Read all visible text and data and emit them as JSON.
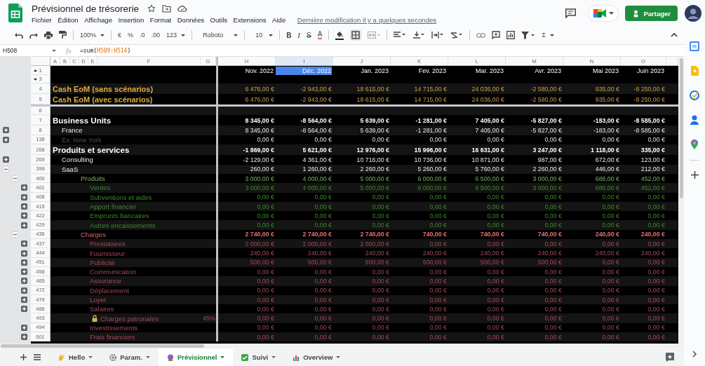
{
  "document": {
    "title": "Prévisionnel de trésorerie",
    "last_edit": "Dernière modification il y a quelques secondes"
  },
  "menu": [
    "Fichier",
    "Édition",
    "Affichage",
    "Insertion",
    "Format",
    "Données",
    "Outils",
    "Extensions",
    "Aide"
  ],
  "share_button": "Partager",
  "toolbar": {
    "zoom": "100%",
    "currency": "€",
    "percent": "%",
    "decimals_less": ".0",
    "decimals_more": ".00",
    "number_format": "123",
    "font": "Roboto",
    "font_size": "10",
    "bold": "B",
    "italic": "I",
    "strikethrough": "S",
    "text_color": "A",
    "functions": "Σ"
  },
  "formula_bar": {
    "cell": "H508",
    "function_label": "fx",
    "prefix": "=sum(",
    "range": "H509:H514",
    "suffix": ")"
  },
  "columns": {
    "frozen": [
      "A",
      "B",
      "C",
      "D",
      "E",
      "F",
      "G"
    ],
    "scrolling": [
      "H",
      "I",
      "J",
      "K",
      "L",
      "M",
      "N",
      "O"
    ]
  },
  "header_row": {
    "number": "1",
    "months": [
      {
        "label": "Nov. 2022",
        "highlighted": false
      },
      {
        "label": "Déc. 2022",
        "highlighted": true
      },
      {
        "label": "Jan. 2023",
        "highlighted": false
      },
      {
        "label": "Fev. 2023",
        "highlighted": false
      },
      {
        "label": "Mar. 2023",
        "highlighted": false
      },
      {
        "label": "Avr. 2023",
        "highlighted": false
      },
      {
        "label": "Mai 2023",
        "highlighted": false
      },
      {
        "label": "Juin 2023",
        "highlighted": false
      }
    ]
  },
  "frozen_rows": [
    {
      "number": "3",
      "kind": "blank"
    },
    {
      "number": "4",
      "kind": "gold",
      "label": "Cash EoM (sans scénarios)",
      "values": [
        "6 476,00 €",
        "-2 943,00 €",
        "18 615,00 €",
        "14 715,00 €",
        "24 036,00 €",
        "-2 580,00 €",
        "935,00 €",
        "-8 250,00 €"
      ]
    },
    {
      "number": "5",
      "kind": "gold",
      "label": "Cash EoM (avec scénarios)",
      "values": [
        "6 476,00 €",
        "-2 943,00 €",
        "18 615,00 €",
        "14 715,00 €",
        "24 036,00 €",
        "-2 580,00 €",
        "935,00 €",
        "-8 250,00 €"
      ]
    }
  ],
  "rows": [
    {
      "number": "6",
      "kind": "blank"
    },
    {
      "number": "7",
      "kind": "title",
      "label": "Business Units",
      "values": [
        "8 345,00 €",
        "-8 564,00 €",
        "5 639,00 €",
        "-1 281,00 €",
        "7 405,00 €",
        "-5 827,00 €",
        "-183,00 €",
        "-8 585,00 €"
      ]
    },
    {
      "number": "8",
      "kind": "item",
      "label": "France",
      "toggle": {
        "kind": "outer",
        "expanded": false
      },
      "values": [
        "8 345,00 €",
        "-8 564,00 €",
        "5 639,00 €",
        "-1 281,00 €",
        "7 405,00 €",
        "-5 827,00 €",
        "-183,00 €",
        "-8 585,00 €"
      ]
    },
    {
      "number": "138",
      "kind": "muted",
      "label": "Ex: New York",
      "toggle": {
        "kind": "outer",
        "expanded": false
      },
      "values": [
        "0,00 €",
        "0,00 €",
        "0,00 €",
        "0,00 €",
        "0,00 €",
        "0,00 €",
        "0,00 €",
        "0,00 €"
      ]
    },
    {
      "number": "268",
      "kind": "title",
      "label": "Produits et services",
      "values": [
        "-1 869,00 €",
        "5 621,00 €",
        "12 976,00 €",
        "15 996,00 €",
        "16 631,00 €",
        "3 247,00 €",
        "1 118,00 €",
        "335,00 €"
      ]
    },
    {
      "number": "269",
      "kind": "item",
      "label": "Consulting",
      "toggle": {
        "kind": "outer",
        "expanded": false
      },
      "values": [
        "-2 129,00 €",
        "4 361,00 €",
        "10 716,00 €",
        "10 736,00 €",
        "10 871,00 €",
        "987,00 €",
        "672,00 €",
        "123,00 €"
      ]
    },
    {
      "number": "399",
      "kind": "item",
      "label": "SaaS",
      "toggle": {
        "kind": "outer",
        "expanded": true
      },
      "values": [
        "260,00 €",
        "1 260,00 €",
        "2 260,00 €",
        "5 260,00 €",
        "5 760,00 €",
        "2 260,00 €",
        "446,00 €",
        "212,00 €"
      ]
    },
    {
      "number": "400",
      "kind": "green-group",
      "label": "Produits",
      "toggle": {
        "kind": "middle",
        "expanded": true
      },
      "values": [
        "3 000,00 €",
        "4 000,00 €",
        "5 000,00 €",
        "6 000,00 €",
        "6 500,00 €",
        "3 000,00 €",
        "686,00 €",
        "452,00 €"
      ]
    },
    {
      "number": "401",
      "kind": "green-item",
      "label": "Ventes",
      "toggle": {
        "kind": "inner",
        "expanded": false
      },
      "values": [
        "3 000,00 €",
        "4 000,00 €",
        "5 000,00 €",
        "6 000,00 €",
        "6 500,00 €",
        "3 000,00 €",
        "686,00 €",
        "452,00 €"
      ]
    },
    {
      "number": "408",
      "kind": "green-item",
      "label": "Subventions et aides",
      "toggle": {
        "kind": "inner",
        "expanded": false
      },
      "values": [
        "0,00 €",
        "0,00 €",
        "0,00 €",
        "0,00 €",
        "0,00 €",
        "0,00 €",
        "0,00 €",
        "0,00 €"
      ]
    },
    {
      "number": "415",
      "kind": "green-item",
      "label": "Apport financier",
      "toggle": {
        "kind": "inner",
        "expanded": false
      },
      "values": [
        "0,00 €",
        "0,00 €",
        "0,00 €",
        "0,00 €",
        "0,00 €",
        "0,00 €",
        "0,00 €",
        "0,00 €"
      ]
    },
    {
      "number": "422",
      "kind": "green-item",
      "label": "Emprunts bancaires",
      "toggle": {
        "kind": "inner",
        "expanded": false
      },
      "values": [
        "0,00 €",
        "0,00 €",
        "0,00 €",
        "0,00 €",
        "0,00 €",
        "0,00 €",
        "0,00 €",
        "0,00 €"
      ]
    },
    {
      "number": "429",
      "kind": "green-item",
      "label": "Autres encaissements",
      "toggle": {
        "kind": "inner",
        "expanded": false
      },
      "values": [
        "0,00 €",
        "0,00 €",
        "0,00 €",
        "0,00 €",
        "0,00 €",
        "0,00 €",
        "0,00 €",
        "0,00 €"
      ]
    },
    {
      "number": "436",
      "kind": "red-group",
      "label": "Charges",
      "toggle": {
        "kind": "middle",
        "expanded": true
      },
      "values": [
        "2 740,00 €",
        "2 740,00 €",
        "2 740,00 €",
        "740,00 €",
        "740,00 €",
        "740,00 €",
        "240,00 €",
        "240,00 €"
      ]
    },
    {
      "number": "437",
      "kind": "red-item",
      "label": "Prestataires",
      "toggle": {
        "kind": "inner",
        "expanded": false
      },
      "values": [
        "2 000,00 €",
        "2 000,00 €",
        "2 000,00 €",
        "0,00 €",
        "0,00 €",
        "0,00 €",
        "0,00 €",
        "0,00 €"
      ]
    },
    {
      "number": "444",
      "kind": "red-item",
      "label": "Fournisseur",
      "toggle": {
        "kind": "inner",
        "expanded": false
      },
      "values": [
        "240,00 €",
        "240,00 €",
        "240,00 €",
        "240,00 €",
        "240,00 €",
        "240,00 €",
        "240,00 €",
        "240,00 €"
      ]
    },
    {
      "number": "451",
      "kind": "red-item",
      "label": "Publicité",
      "toggle": {
        "kind": "inner",
        "expanded": false
      },
      "values": [
        "500,00 €",
        "500,00 €",
        "500,00 €",
        "500,00 €",
        "500,00 €",
        "500,00 €",
        "0,00 €",
        "0,00 €"
      ]
    },
    {
      "number": "458",
      "kind": "red-item",
      "label": "Communication",
      "toggle": {
        "kind": "inner",
        "expanded": false
      },
      "values": [
        "0,00 €",
        "0,00 €",
        "0,00 €",
        "0,00 €",
        "0,00 €",
        "0,00 €",
        "0,00 €",
        "0,00 €"
      ]
    },
    {
      "number": "465",
      "kind": "red-item",
      "label": "Assurance",
      "toggle": {
        "kind": "inner",
        "expanded": false
      },
      "values": [
        "0,00 €",
        "0,00 €",
        "0,00 €",
        "0,00 €",
        "0,00 €",
        "0,00 €",
        "0,00 €",
        "0,00 €"
      ]
    },
    {
      "number": "472",
      "kind": "red-item",
      "label": "Déplacement",
      "toggle": {
        "kind": "inner",
        "expanded": false
      },
      "values": [
        "0,00 €",
        "0,00 €",
        "0,00 €",
        "0,00 €",
        "0,00 €",
        "0,00 €",
        "0,00 €",
        "0,00 €"
      ]
    },
    {
      "number": "479",
      "kind": "red-item",
      "label": "Loyer",
      "toggle": {
        "kind": "inner",
        "expanded": false
      },
      "values": [
        "0,00 €",
        "0,00 €",
        "0,00 €",
        "0,00 €",
        "0,00 €",
        "0,00 €",
        "0,00 €",
        "0,00 €"
      ]
    },
    {
      "number": "486",
      "kind": "red-item",
      "label": "Salaires",
      "toggle": {
        "kind": "inner",
        "expanded": false
      },
      "values": [
        "0,00 €",
        "0,00 €",
        "0,00 €",
        "0,00 €",
        "0,00 €",
        "0,00 €",
        "0,00 €",
        "0,00 €"
      ]
    },
    {
      "number": "493",
      "kind": "red-sub",
      "label": "Charges patronales",
      "locked": true,
      "percent": "45%",
      "values": [
        "0,00 €",
        "0,00 €",
        "0,00 €",
        "0,00 €",
        "0,00 €",
        "0,00 €",
        "0,00 €",
        "0,00 €"
      ]
    },
    {
      "number": "494",
      "kind": "red-item",
      "label": "Investissements",
      "toggle": {
        "kind": "inner",
        "expanded": false
      },
      "values": [
        "0,00 €",
        "0,00 €",
        "0,00 €",
        "0,00 €",
        "0,00 €",
        "0,00 €",
        "0,00 €",
        "0,00 €"
      ]
    },
    {
      "number": "501",
      "kind": "red-item",
      "label": "Frais financiers",
      "toggle": {
        "kind": "inner",
        "expanded": false
      },
      "values": [
        "0,00 €",
        "0,00 €",
        "0,00 €",
        "0,00 €",
        "0,00 €",
        "0,00 €",
        "0,00 €",
        "0,00 €"
      ]
    }
  ],
  "sheets": [
    {
      "name": "Hello",
      "selected": false
    },
    {
      "name": "Param.",
      "selected": false
    },
    {
      "name": "Prévisionnel",
      "selected": true
    },
    {
      "name": "Suivi",
      "selected": false
    },
    {
      "name": "Overview",
      "selected": false
    }
  ]
}
